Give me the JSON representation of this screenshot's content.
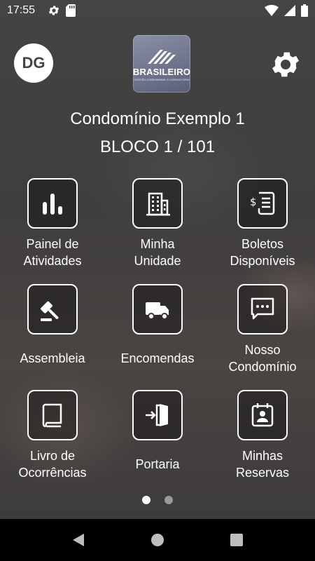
{
  "status_bar": {
    "time": "17:55",
    "icons_left": [
      "settings-icon",
      "sd-card-icon"
    ],
    "icons_right": [
      "wifi-icon",
      "signal-icon",
      "battery-icon"
    ]
  },
  "header": {
    "avatar_initials": "DG",
    "logo_brand": "BRASILEIRO",
    "logo_tagline": "GESTÃO CONDOMINIAL E CONSULTORIA",
    "settings_icon": "gear-icon"
  },
  "condo": {
    "name": "Condomínio Exemplo 1",
    "unit": "BLOCO 1 / 101"
  },
  "menu": [
    {
      "label": "Painel de\nAtividades",
      "icon": "bar-chart-icon"
    },
    {
      "label": "Minha\nUnidade",
      "icon": "building-icon"
    },
    {
      "label": "Boletos\nDisponíveis",
      "icon": "invoice-icon"
    },
    {
      "label": "Assembleia",
      "icon": "gavel-icon"
    },
    {
      "label": "Encomendas",
      "icon": "truck-icon"
    },
    {
      "label": "Nosso\nCondomínio",
      "icon": "chat-icon"
    },
    {
      "label": "Livro de\nOcorrências",
      "icon": "book-icon"
    },
    {
      "label": "Portaria",
      "icon": "door-enter-icon"
    },
    {
      "label": "Minhas\nReservas",
      "icon": "calendar-person-icon"
    }
  ],
  "pagination": {
    "pages": 2,
    "current": 1
  },
  "colors": {
    "accent": "#ffffff",
    "dot_inactive": "#9a9a9a",
    "navbar": "#000000"
  }
}
